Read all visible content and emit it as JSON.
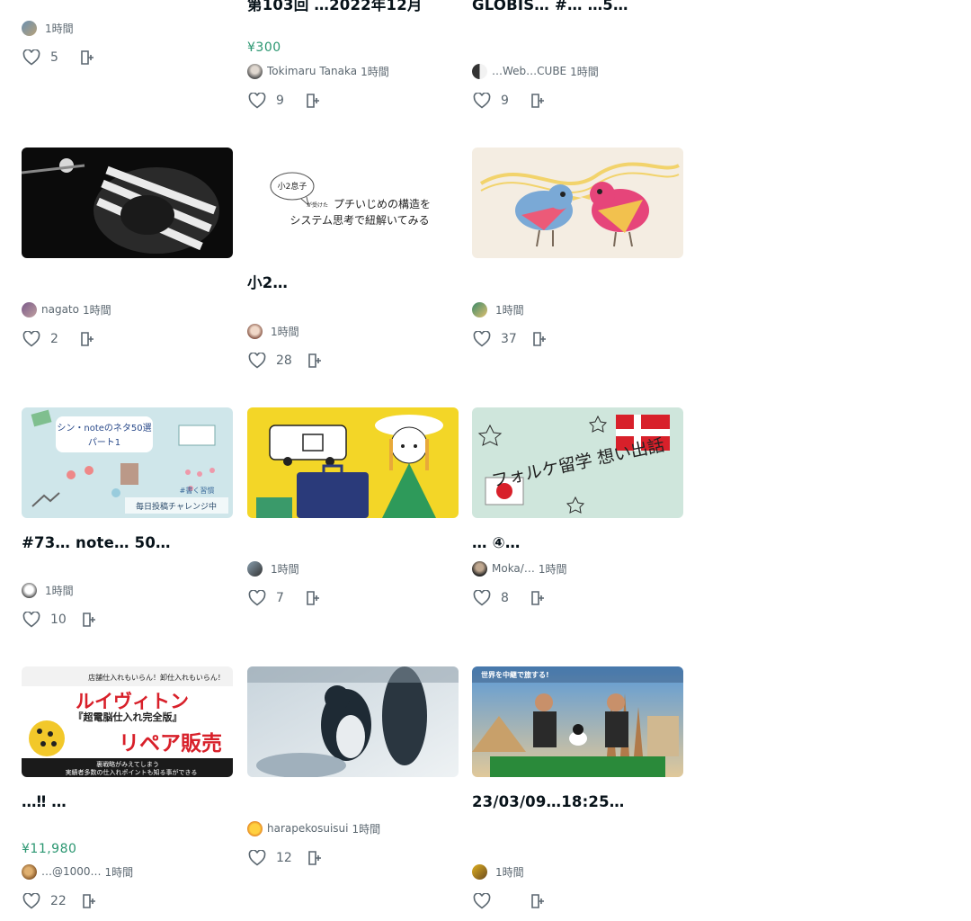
{
  "cards": [
    {
      "title": "",
      "title_visible": "…",
      "author": "",
      "time": "1時間",
      "likes": "5"
    },
    {
      "title": "第103回 …2022年12月",
      "price": "¥300",
      "author": "Tokimaru Tanaka",
      "time": "1時間",
      "likes": "9"
    },
    {
      "title": "GLOBIS… #… …5…",
      "author": "…Web…CUBE",
      "time": "1時間",
      "likes": "9"
    },
    {
      "title": "",
      "author": "nagato",
      "time": "1時間",
      "likes": "2"
    },
    {
      "title": "小2…",
      "thumb_text_small": "小2息子",
      "thumb_text_mid": "が受けた",
      "thumb_line1": "プチいじめの構造を",
      "thumb_line2": "システム思考で紐解いてみる",
      "author": "",
      "time": "1時間",
      "likes": "28"
    },
    {
      "title": "",
      "author": "",
      "time": "1時間",
      "likes": "37"
    },
    {
      "title": "#73… note… 50…",
      "thumb_line1": "シン・noteのネタ50選",
      "thumb_line2": "パート1",
      "thumb_tag": "#書く習慣",
      "thumb_footer": "毎日投稿チャレンジ中",
      "author": "",
      "time": "1時間",
      "likes": "10"
    },
    {
      "title": "",
      "author": "",
      "time": "1時間",
      "likes": "7"
    },
    {
      "title": "… ④…",
      "thumb_text": "フォルケ留学 想い出話",
      "author": "Moka/…",
      "time": "1時間",
      "likes": "8"
    },
    {
      "title": "…‼ …",
      "price": "¥11,980",
      "thumb_top": "店舗仕入れもいらん！卸仕入れもいらん！",
      "thumb_main": "ルイヴィトン",
      "thumb_sub": "『超電脳仕入れ完全版』",
      "thumb_main2": "リペア販売",
      "thumb_note": "裏戦略がみえてしまう",
      "thumb_bottom": "実績者多数の仕入れポイントも知る事ができる",
      "author": "…@1000…",
      "time": "1時間",
      "likes": "22"
    },
    {
      "title": "",
      "author": "harapekosuisui",
      "time": "1時間",
      "likes": "12"
    },
    {
      "title": "23/03/09…18:25…",
      "thumb_text": "世界を中継で旅する!",
      "author": "",
      "time": "1時間",
      "likes": ""
    }
  ],
  "colors": {
    "price": "#2a9670",
    "text": "#08131a",
    "muted": "#5b6770"
  },
  "icons": {
    "like": "heart-icon",
    "save": "magazine-add-icon"
  }
}
